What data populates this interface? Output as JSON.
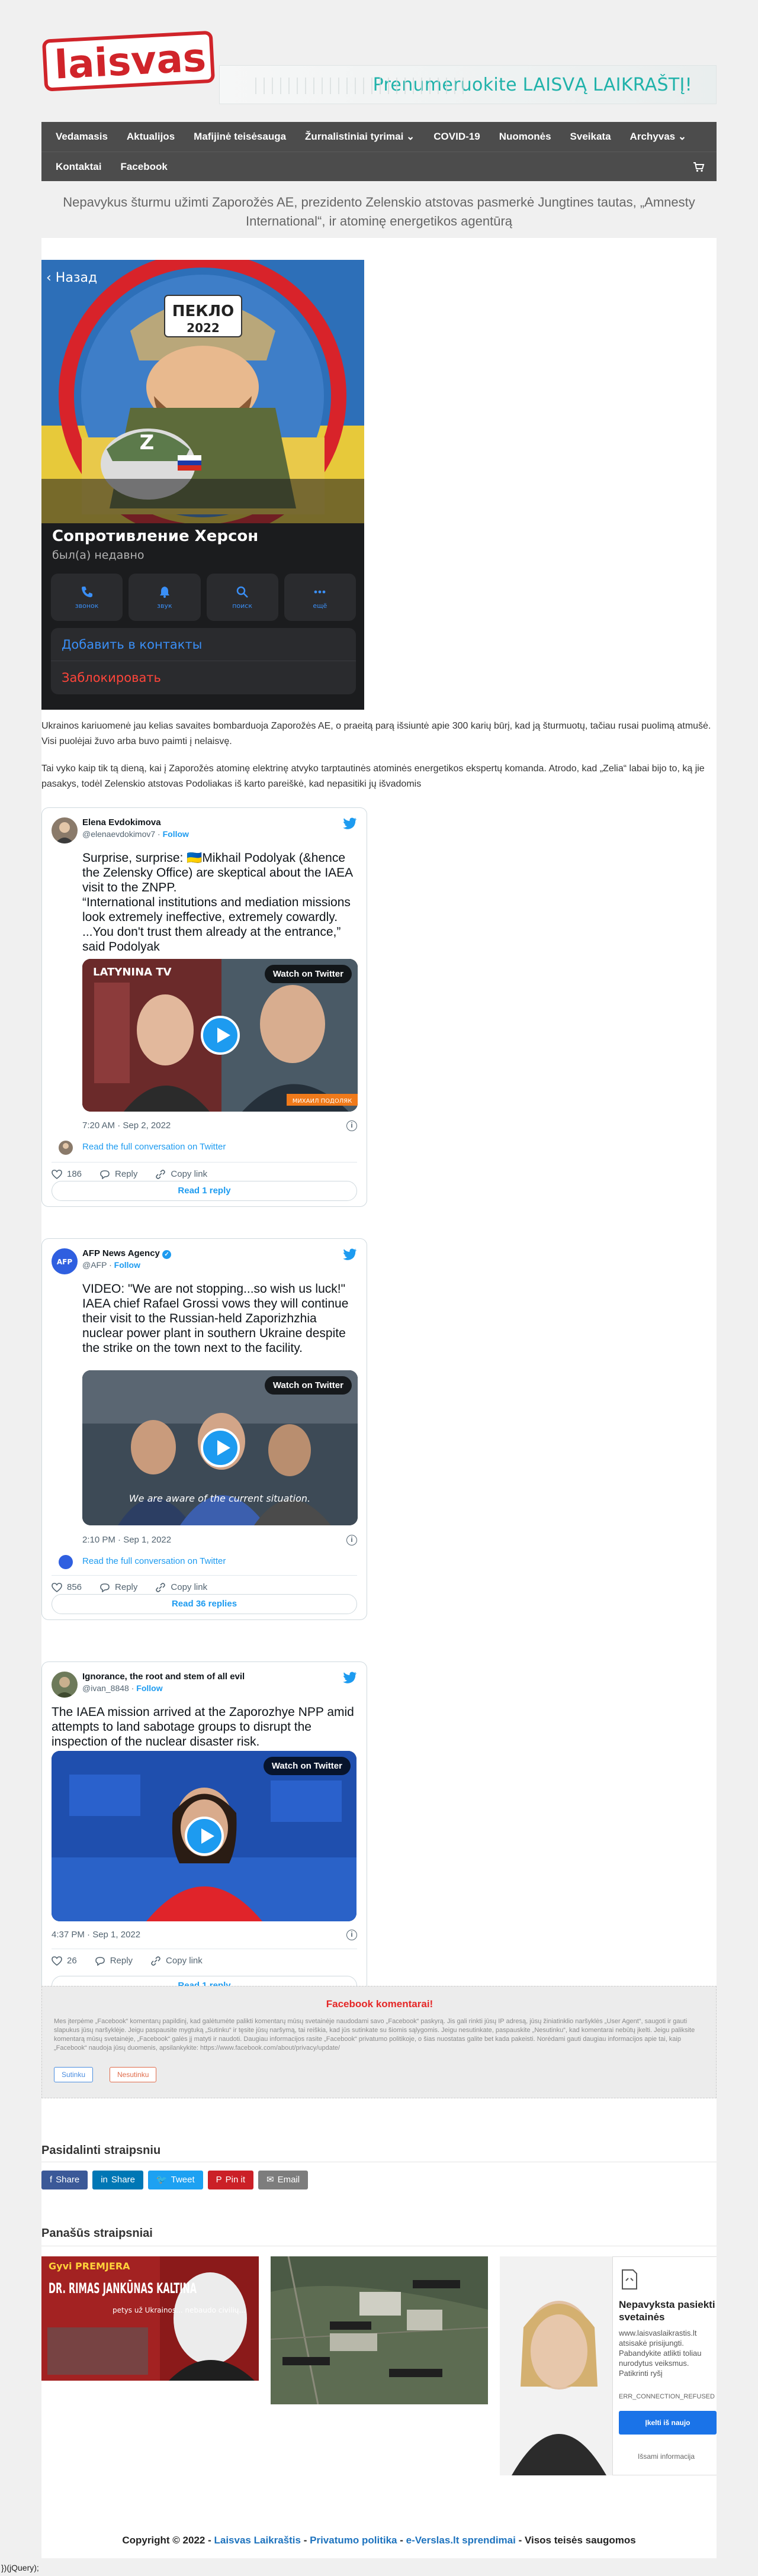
{
  "header": {
    "logo_text": "laisvas",
    "banner_text": "Prenumeruokite LAISVĄ LAIKRAŠTĮ!"
  },
  "nav": {
    "row1": [
      "Vedamasis",
      "Aktualijos",
      "Mafijinė teisėsauga",
      "Žurnalistiniai tyrimai ⌄",
      "COVID-19",
      "Nuomonės",
      "Sveikata",
      "Archyvas ⌄"
    ],
    "row2": [
      "Kontaktai",
      "Facebook"
    ]
  },
  "article": {
    "subtitle": "Nepavykus šturmu užimti Zaporožės AE, prezidento Zelenskio atstovas pasmerkė Jungtines tautas, „Amnesty International“, ir atominę energetikos agentūrą",
    "para1": "Ukrainos kariuomenė jau kelias savaites bombarduoja Zaporožės AE, o praeitą parą išsiuntė apie 300 karių būrį, kad ją šturmuotų, tačiau rusai puolimą atmušė. Visi puolėjai žuvo arba buvo paimti į nelaisvę.",
    "para2": "Tai vyko kaip tik tą dieną, kai į Zaporožės atominę elektrinę atvyko tarptautinės atominės energetikos ekspertų komanda. Atrodo, kad „Zelia“ labai bijo to, ką jie pasakys, todėl Zelenskio atstovas Podoliakas iš karto pareiškė, kad nepasitiki jų išvadomis"
  },
  "phone": {
    "back": "Назад",
    "patch_text": "ПЕКЛО",
    "patch_year": "2022",
    "name": "Сопротивление Херсон",
    "status": "был(а) недавно",
    "actions": [
      "звонок",
      "звук",
      "поиск",
      "ещё"
    ],
    "add_contact": "Добавить в контакты",
    "block": "Заблокировать"
  },
  "tweets": [
    {
      "name": "Elena Evdokimova",
      "handle": "@elenaevdokimov7",
      "follow": "Follow",
      "text": "Surprise, surprise: 🇺🇦Mikhail Podolyak (&hence the Zelensky Office) are skeptical about the IAEA visit to the ZNPP.\n“International institutions and mediation missions look extremely ineffective, extremely cowardly. ...You don't trust them already at the entrance,” said Podolyak",
      "watch": "Watch on Twitter",
      "media_tag": "LATYNINA TV",
      "media_caption": "МИХАИЛ ПОДОЛЯК",
      "time": "7:20 AM · Sep 2, 2022",
      "read_conv": "Read the full conversation on Twitter",
      "likes": "186",
      "reply": "Reply",
      "copy": "Copy link",
      "read_replies": "Read 1 reply"
    },
    {
      "name": "AFP News Agency",
      "handle": "@AFP",
      "follow": "Follow",
      "avatar_text": "AFP",
      "text": "VIDEO: \"We are not stopping...so wish us luck!\"\nIAEA chief Rafael Grossi vows they will continue their visit to the Russian-held Zaporizhzhia nuclear power plant in southern Ukraine despite the strike on the town next to the facility.",
      "watch": "Watch on Twitter",
      "media_caption": "We are aware of the current situation.",
      "time": "2:10 PM · Sep 1, 2022",
      "read_conv": "Read the full conversation on Twitter",
      "likes": "856",
      "reply": "Reply",
      "copy": "Copy link",
      "read_replies": "Read 36 replies"
    },
    {
      "name": "Ignorance, the root and stem of all evil",
      "handle": "@ivan_8848",
      "follow": "Follow",
      "text": "The IAEA mission arrived at the Zaporozhye NPP amid attempts to land sabotage groups to disrupt the inspection of the nuclear disaster risk.",
      "watch": "Watch on Twitter",
      "time": "4:37 PM · Sep 1, 2022",
      "likes": "26",
      "reply": "Reply",
      "copy": "Copy link",
      "read_replies": "Read 1 reply"
    }
  ],
  "facebook": {
    "title": "Facebook komentarai!",
    "text": "Mes įterpėme „Facebook“ komentarų papildinį, kad galėtumėte palikti komentarų mūsų svetainėje naudodami savo „Facebook“ paskyrą. Jis gali rinkti jūsų IP adresą, jūsų žiniatinklio naršyklės „User Agent“, saugoti ir gauti slapukus jūsų naršyklėje. Jeigu paspausite mygtuką „Sutinku“ ir tęsite jūsų naršymą, tai reiškia, kad jūs sutinkate su šiomis sąlygomis. Jeigu nesutinkate, paspauskite „Nesutinku“, kad komentarai nebūtų įkelti. Jeigu paliksite komentarą mūsų svetainėje, „Facebook“ galės jį matyti ir naudoti. Daugiau informacijos rasite „Facebook“ privatumo politikoje, o šias nuostatas galite bet kada pakeisti. Norėdami gauti daugiau informacijos apie tai, kaip „Facebook“ naudoja jūsų duomenis, apsilankykite: https://www.facebook.com/about/privacy/update/",
    "agree": "Sutinku",
    "decline": "Nesutinku"
  },
  "share": {
    "title": "Pasidalinti straipsniu",
    "buttons": [
      {
        "label": "Share",
        "color": "#3b5998",
        "icon": "f"
      },
      {
        "label": "Share",
        "color": "#0077b5",
        "icon": "in"
      },
      {
        "label": "Tweet",
        "color": "#1da1f2",
        "icon": "t"
      },
      {
        "label": "Pin it",
        "color": "#cb2027",
        "icon": "p"
      },
      {
        "label": "Email",
        "color": "#7d7d7d",
        "icon": "✉"
      }
    ]
  },
  "related": {
    "title": "Panašūs straipsniai",
    "items": [
      {
        "headline": "DR. RIMAS JANKŪNAS KALTINA",
        "kicker": "Gyvi PREMJERA",
        "sub": "petys už Ukrainos... nebaudo civilių..."
      },
      {
        "headline": "",
        "kicker": "",
        "sub": ""
      },
      {
        "headline": "",
        "kicker": "",
        "sub": ""
      }
    ],
    "ad": {
      "title": "Nepavyksta pasiekti svetainės",
      "body": "www.laisvaslaikrastis.lt atsisakė prisijungti.\nPabandykite atlikti toliau nurodytus veiksmus.\nPatikrinti ryšį",
      "error": "ERR_CONNECTION_REFUSED",
      "button": "Įkelti iš naujo",
      "more": "Išsami informacija"
    }
  },
  "footer": {
    "copyright": "Copyright © 2022 -",
    "brand": "Laisvas Laikraštis",
    "sep1": "-",
    "privacy": "Privatumo politika",
    "sep2": "-",
    "solutions": "e-Verslas.lt sprendimai",
    "rights": "- Visos teisės saugomos"
  },
  "page_tail": "})(jQuery);"
}
